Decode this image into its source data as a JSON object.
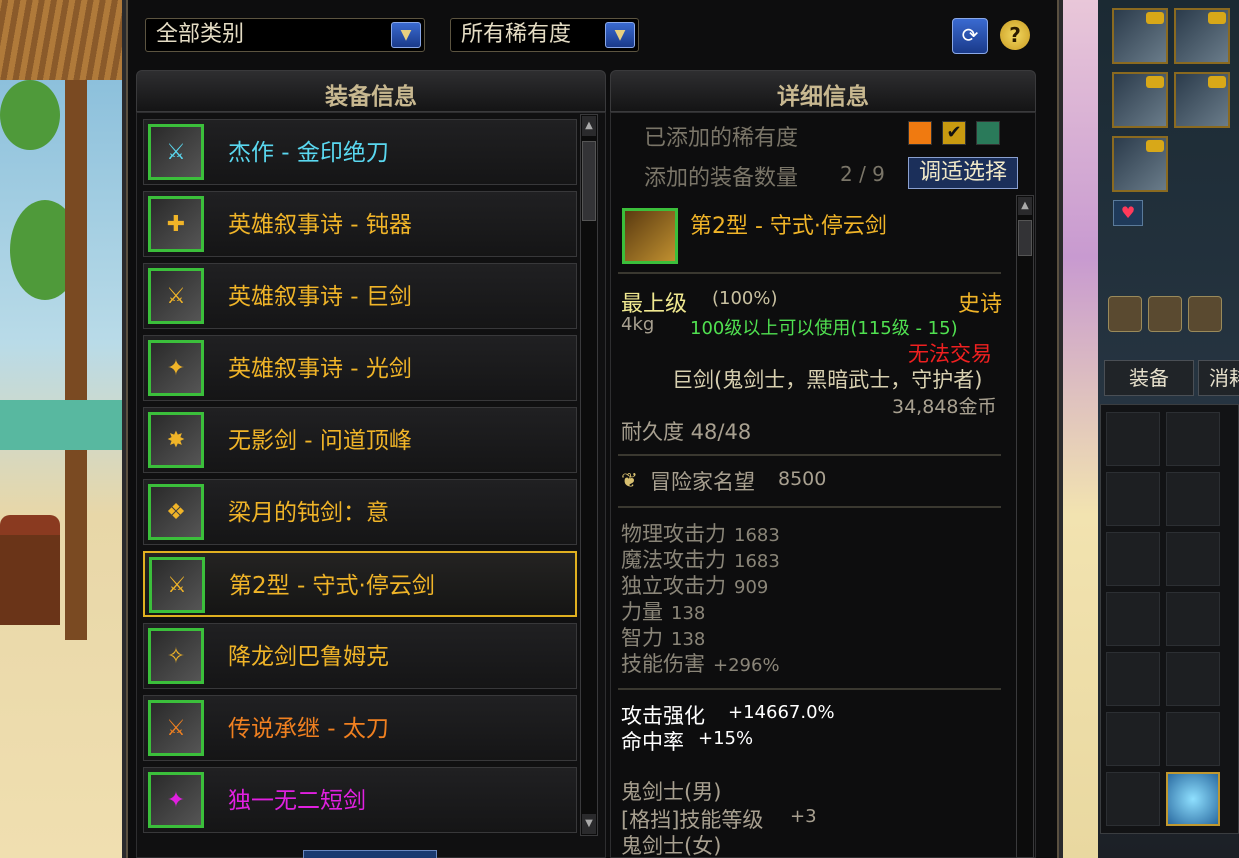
{
  "filters": {
    "category": "全部类别",
    "rarity": "所有稀有度"
  },
  "panels": {
    "list_title": "装备信息",
    "detail_title": "详细信息"
  },
  "colors": {
    "epic": "#f0b428",
    "legendary": "#f08020",
    "unique": "#e020e0",
    "masterpiece": "#5ad8f0",
    "usable": "#50e050",
    "untradeable": "#f02020"
  },
  "items": [
    {
      "name": "杰作 - 金印绝刀",
      "rarity": "masterpiece",
      "icon": "sword-icon"
    },
    {
      "name": "英雄叙事诗 - 钝器",
      "rarity": "epic",
      "icon": "club-icon"
    },
    {
      "name": "英雄叙事诗 - 巨剑",
      "rarity": "epic",
      "icon": "greatsword-icon"
    },
    {
      "name": "英雄叙事诗 - 光剑",
      "rarity": "epic",
      "icon": "lightsaber-icon"
    },
    {
      "name": "无影剑 - 问道顶峰",
      "rarity": "epic",
      "icon": "shadow-sword-icon"
    },
    {
      "name": "梁月的钝剑：意",
      "rarity": "epic",
      "icon": "blunt-sword-icon"
    },
    {
      "name": "第2型 - 守式·停云剑",
      "rarity": "epic",
      "icon": "cloud-sword-icon",
      "selected": true
    },
    {
      "name": "降龙剑巴鲁姆克",
      "rarity": "epic",
      "icon": "dragon-sword-icon"
    },
    {
      "name": "传说承继 - 太刀",
      "rarity": "legendary",
      "icon": "katana-icon"
    },
    {
      "name": "独一无二短剑",
      "rarity": "unique",
      "icon": "short-sword-icon"
    }
  ],
  "detail": {
    "added_rarity_label": "已添加的稀有度",
    "added_count_label": "添加的装备数量",
    "added_count": "2 / 9",
    "adjust_button": "调适选择",
    "item_name": "第2型 - 守式·停云剑",
    "grade": "最上级",
    "grade_percent": "(100%)",
    "rarity_text": "史诗",
    "weight": "4kg",
    "level_req": "100级以上可以使用(115级 - 15)",
    "trade": "无法交易",
    "type": "巨剑(鬼剑士，黑暗武士，守护者)",
    "price": "34,848金币",
    "durability": "耐久度 48/48",
    "fame_label": "冒险家名望",
    "fame_value": "8500",
    "stats": [
      {
        "label": "物理攻击力",
        "value": "1683"
      },
      {
        "label": "魔法攻击力",
        "value": "1683"
      },
      {
        "label": "独立攻击力",
        "value": "909"
      },
      {
        "label": "力量",
        "value": "138"
      },
      {
        "label": "智力",
        "value": "138"
      },
      {
        "label": "技能伤害",
        "value": "+296%"
      }
    ],
    "attack_boost_label": "攻击强化",
    "attack_boost_value": "+14667.0%",
    "hit_label": "命中率",
    "hit_value": "+15%",
    "class1": "鬼剑士(男)",
    "skill_label": "[格挡]技能等级",
    "skill_value": "+3",
    "class2": "鬼剑士(女)"
  },
  "side": {
    "tab_equip": "装备",
    "tab_consume": "消耗"
  }
}
